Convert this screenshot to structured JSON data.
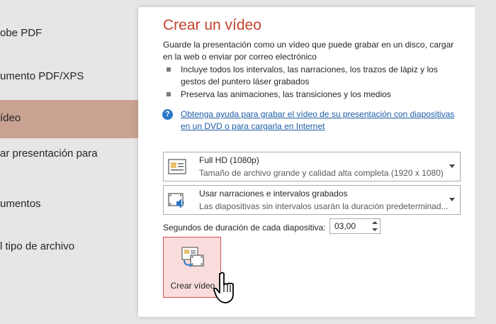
{
  "sidebar": {
    "items": [
      {
        "label": "obe PDF"
      },
      {
        "label": "umento PDF/XPS"
      },
      {
        "label": "ídeo"
      },
      {
        "label": "ar presentación para"
      },
      {
        "label": "umentos"
      },
      {
        "label": "l tipo de archivo"
      }
    ],
    "selected_color": "#c9a292"
  },
  "panel": {
    "title": "Crear un vídeo",
    "title_color": "#c4432d",
    "description": "Guarde la presentación como un vídeo que puede grabar en un disco, cargar en la web o enviar por correo electrónico",
    "bullets": [
      "Incluye todos los intervalos, las narraciones, los trazos de lápiz y los gestos del puntero láser grabados",
      "Preserva las animaciones, las transiciones y los medios"
    ],
    "help_icon": "?",
    "help_link": "Obtenga ayuda para grabar el vídeo de su presentación con diapositivas en un DVD o para cargarla en Internet"
  },
  "quality_dropdown": {
    "icon": "presentation-quality-icon",
    "label": "Full HD (1080p)",
    "sub": "Tamaño de archivo grande y calidad alta completa (1920 x 1080)"
  },
  "narration_dropdown": {
    "icon": "film-speaker-icon",
    "label": "Usar narraciones e intervalos grabados",
    "sub": "Las diapositivas sin intervalos usarán la duración predeterminad..."
  },
  "duration": {
    "label": "Segundos de duración de cada diapositiva:",
    "value": "03,00"
  },
  "create_button": {
    "label": "Crear vídeo",
    "icon": "create-video-icon",
    "bg_color": "#f9dcdc",
    "border_color": "#d9534f"
  }
}
